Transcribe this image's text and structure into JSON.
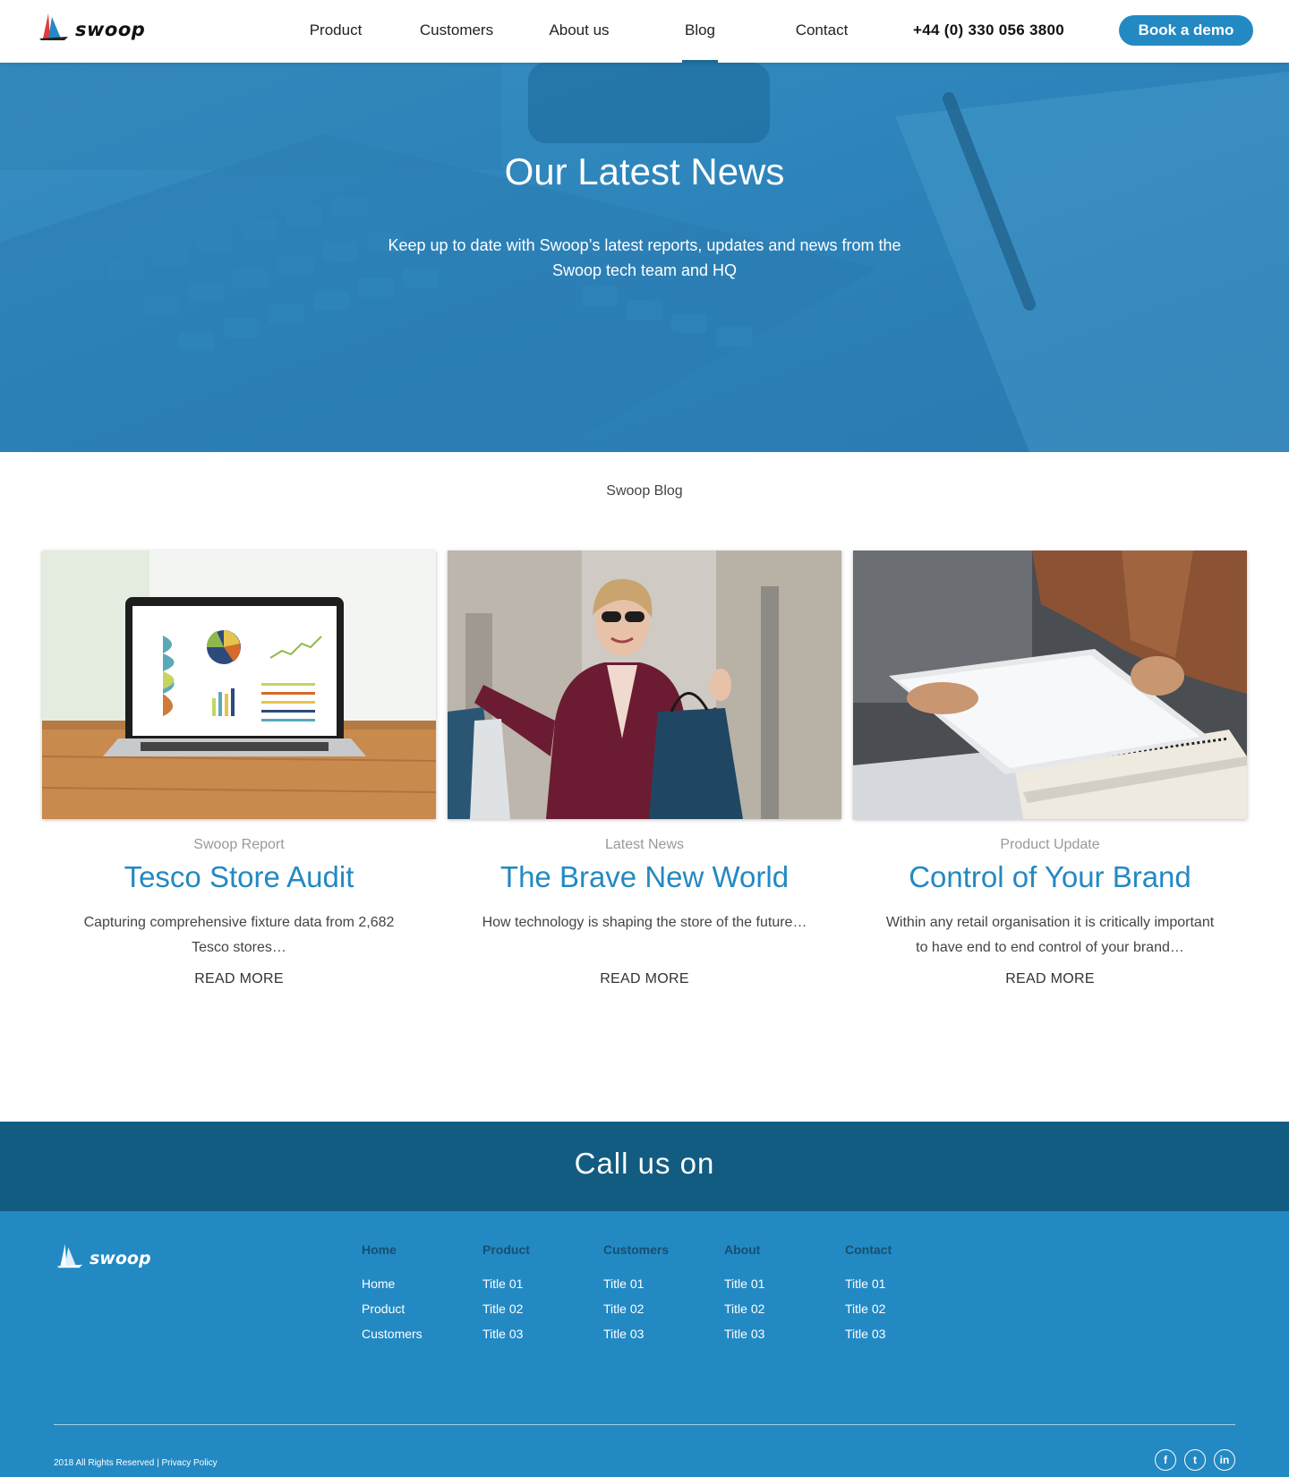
{
  "brand": {
    "name": "swoop",
    "accent": "#2389c3",
    "dark": "#125b81"
  },
  "nav": {
    "items": [
      "Product",
      "Customers",
      "About us",
      "Blog",
      "Contact"
    ],
    "active": "Blog",
    "phone": "+44 (0) 330 056 3800",
    "cta": "Book a demo"
  },
  "hero": {
    "title": "Our Latest News",
    "subtitle": "Keep up to date with Swoop’s latest reports, updates and news from the Swoop tech team and HQ"
  },
  "blog": {
    "label": "Swoop Blog",
    "cards": [
      {
        "category": "Swoop Report",
        "title": "Tesco Store Audit",
        "description": "Capturing comprehensive fixture data from 2,682 Tesco stores…",
        "more": "READ MORE",
        "image": "laptop-dashboard"
      },
      {
        "category": "Latest News",
        "title": "The Brave New World",
        "description": "How technology is shaping the store of the future…",
        "more": "READ MORE",
        "image": "shopper-with-bags"
      },
      {
        "category": "Product Update",
        "title": "Control of Your Brand",
        "description": "Within any retail organisation it is critically important to have end to end control of your brand…",
        "more": "READ MORE",
        "image": "tablet-notebook"
      }
    ]
  },
  "call": {
    "text": "Call us on"
  },
  "footer": {
    "brand": "swoop",
    "columns": [
      {
        "heading": "Home",
        "links": [
          "Home",
          "Product",
          "Customers"
        ]
      },
      {
        "heading": "Product",
        "links": [
          "Title 01",
          "Title 02",
          "Title 03"
        ]
      },
      {
        "heading": "Customers",
        "links": [
          "Title 01",
          "Title 02",
          "Title 03"
        ]
      },
      {
        "heading": "About",
        "links": [
          "Title 01",
          "Title 02",
          "Title 03"
        ]
      },
      {
        "heading": "Contact",
        "links": [
          "Title 01",
          "Title 02",
          "Title 03"
        ]
      }
    ],
    "copyright": "2018 All Rights Reserved | Privacy Policy",
    "socials": [
      {
        "icon": "facebook-icon",
        "glyph": "f"
      },
      {
        "icon": "twitter-icon",
        "glyph": "t"
      },
      {
        "icon": "linkedin-icon",
        "glyph": "in"
      }
    ]
  }
}
